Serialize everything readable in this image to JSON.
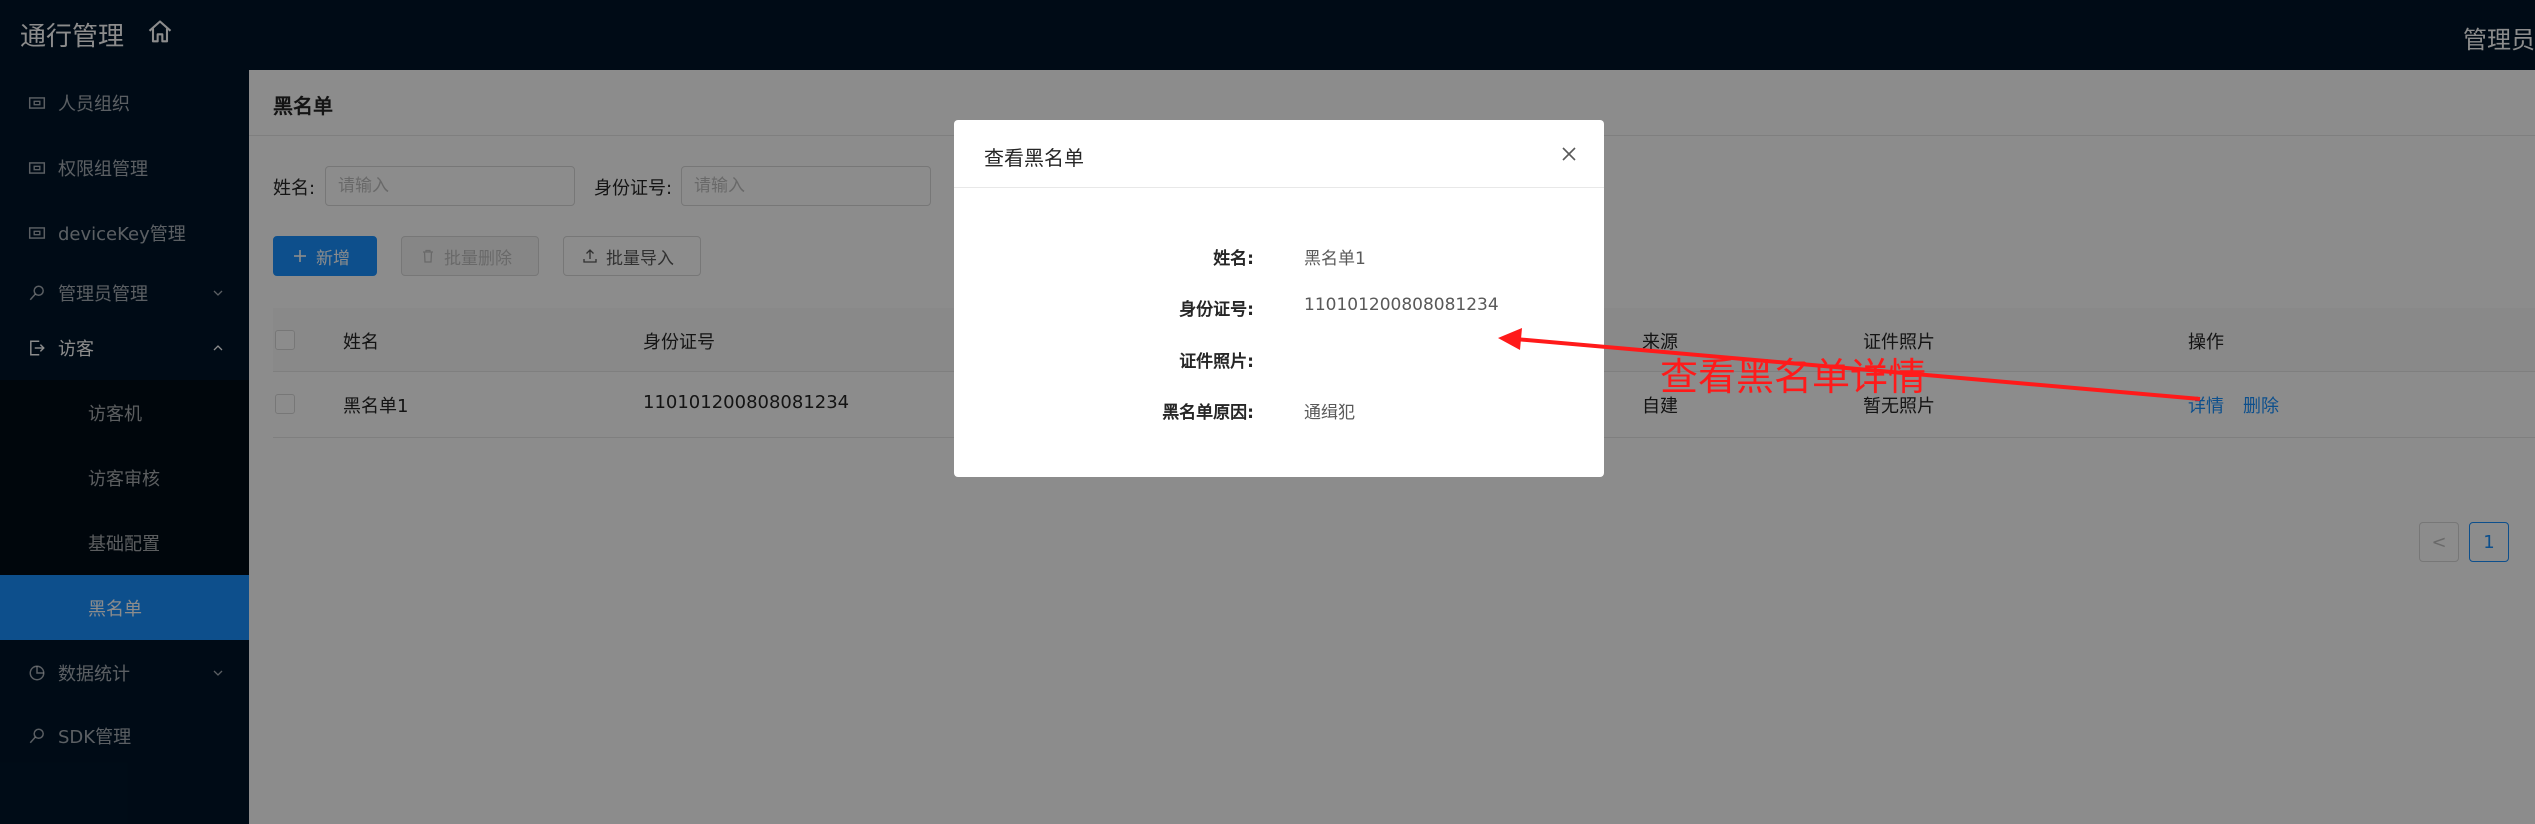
{
  "header": {
    "app_title": "通行管理",
    "admin_label": "管理员"
  },
  "sidebar": {
    "items": [
      {
        "label": "人员组织",
        "icon": "box-icon"
      },
      {
        "label": "权限组管理",
        "icon": "box-icon"
      },
      {
        "label": "deviceKey管理",
        "icon": "box-icon"
      },
      {
        "label": "管理员管理",
        "icon": "key-icon"
      },
      {
        "label": "访客",
        "icon": "door-icon"
      },
      {
        "label": "数据统计",
        "icon": "pie-chart-icon"
      },
      {
        "label": "SDK管理",
        "icon": "key-icon"
      }
    ],
    "visitor_submenu": [
      {
        "label": "访客机"
      },
      {
        "label": "访客审核"
      },
      {
        "label": "基础配置"
      },
      {
        "label": "黑名单",
        "active": true
      }
    ]
  },
  "page": {
    "title": "黑名单",
    "search": {
      "name_label": "姓名:",
      "name_placeholder": "请输入",
      "id_label": "身份证号:",
      "id_placeholder": "请输入"
    },
    "toolbar": {
      "add_label": "新增",
      "batch_delete_label": "批量删除",
      "batch_import_label": "批量导入"
    },
    "table": {
      "columns": [
        "姓名",
        "身份证号",
        "来源",
        "证件照片",
        "操作"
      ],
      "rows": [
        {
          "name": "黑名单1",
          "id_number": "110101200808081234",
          "source": "自建",
          "photo": "暂无照片",
          "actions": [
            "详情",
            "删除"
          ]
        }
      ]
    },
    "pagination": {
      "prev": "<",
      "current": "1"
    }
  },
  "modal": {
    "title": "查看黑名单",
    "fields": [
      {
        "label": "姓名:",
        "value": "黑名单1"
      },
      {
        "label": "身份证号:",
        "value": "110101200808081234"
      },
      {
        "label": "证件照片:",
        "value": ""
      },
      {
        "label": "黑名单原因:",
        "value": "通缉犯"
      }
    ]
  },
  "annotation": {
    "text": "查看黑名单详情",
    "color": "#ff1a1a"
  },
  "colors": {
    "header_bg": "#001529",
    "accent": "#1890ff",
    "annotation": "#ff1a1a"
  }
}
